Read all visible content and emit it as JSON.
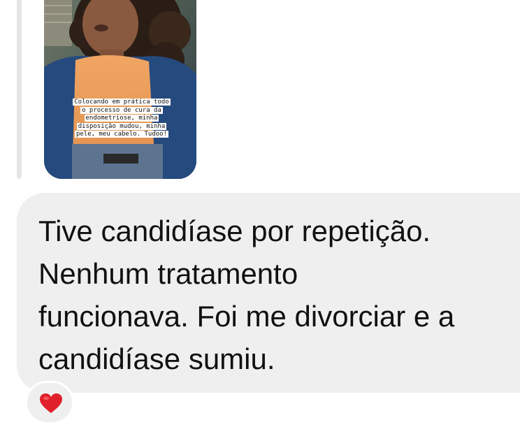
{
  "story_reply": {
    "caption_lines": [
      "Colocando em prática todo",
      "o processo de cura da",
      "endometriose, minha",
      "disposição mudou, minha",
      "pele, meu cabelo. Tudoo!"
    ]
  },
  "message": {
    "lines": [
      "Tive candidíase por repetição.",
      "Nenhum tratamento",
      "funcionava. Foi me divorciar e a",
      "candidíase sumiu."
    ]
  },
  "reaction": {
    "icon": "red-heart-icon",
    "color": "#e0202a"
  },
  "colors": {
    "bubble": "#efefef",
    "reply_bar": "#e6e6e6",
    "text": "#111111"
  }
}
